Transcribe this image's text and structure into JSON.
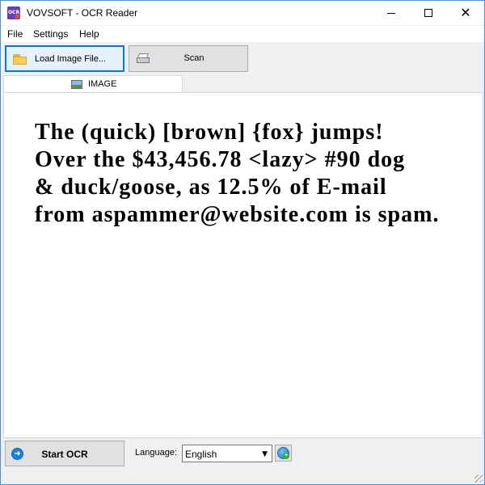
{
  "window": {
    "title": "VOVSOFT - OCR Reader",
    "app_icon_text": "OCR"
  },
  "controls": {
    "minimize": "minimize",
    "maximize": "maximize",
    "close": "✕"
  },
  "menu": {
    "file": "File",
    "settings": "Settings",
    "help": "Help"
  },
  "toolbar": {
    "load_label": "Load Image File...",
    "scan_label": "Scan"
  },
  "tab": {
    "label": "IMAGE"
  },
  "image": {
    "lines": [
      "The (quick) [brown] {fox} jumps!",
      "Over the $43,456.78 <lazy> #90 dog",
      "& duck/goose, as 12.5% of E-mail",
      "from aspammer@website.com is spam."
    ]
  },
  "bottom": {
    "start_label": "Start OCR",
    "language_label": "Language:",
    "language_value": "English"
  },
  "icons": {
    "folder": "folder-icon",
    "scanner": "scanner-icon",
    "image": "image-icon",
    "start": "arrow-right-icon",
    "globe": "globe-add-icon"
  },
  "colors": {
    "accent": "#0078d7",
    "window_bg": "#f0f0f0",
    "content_bg": "#ffffff"
  }
}
